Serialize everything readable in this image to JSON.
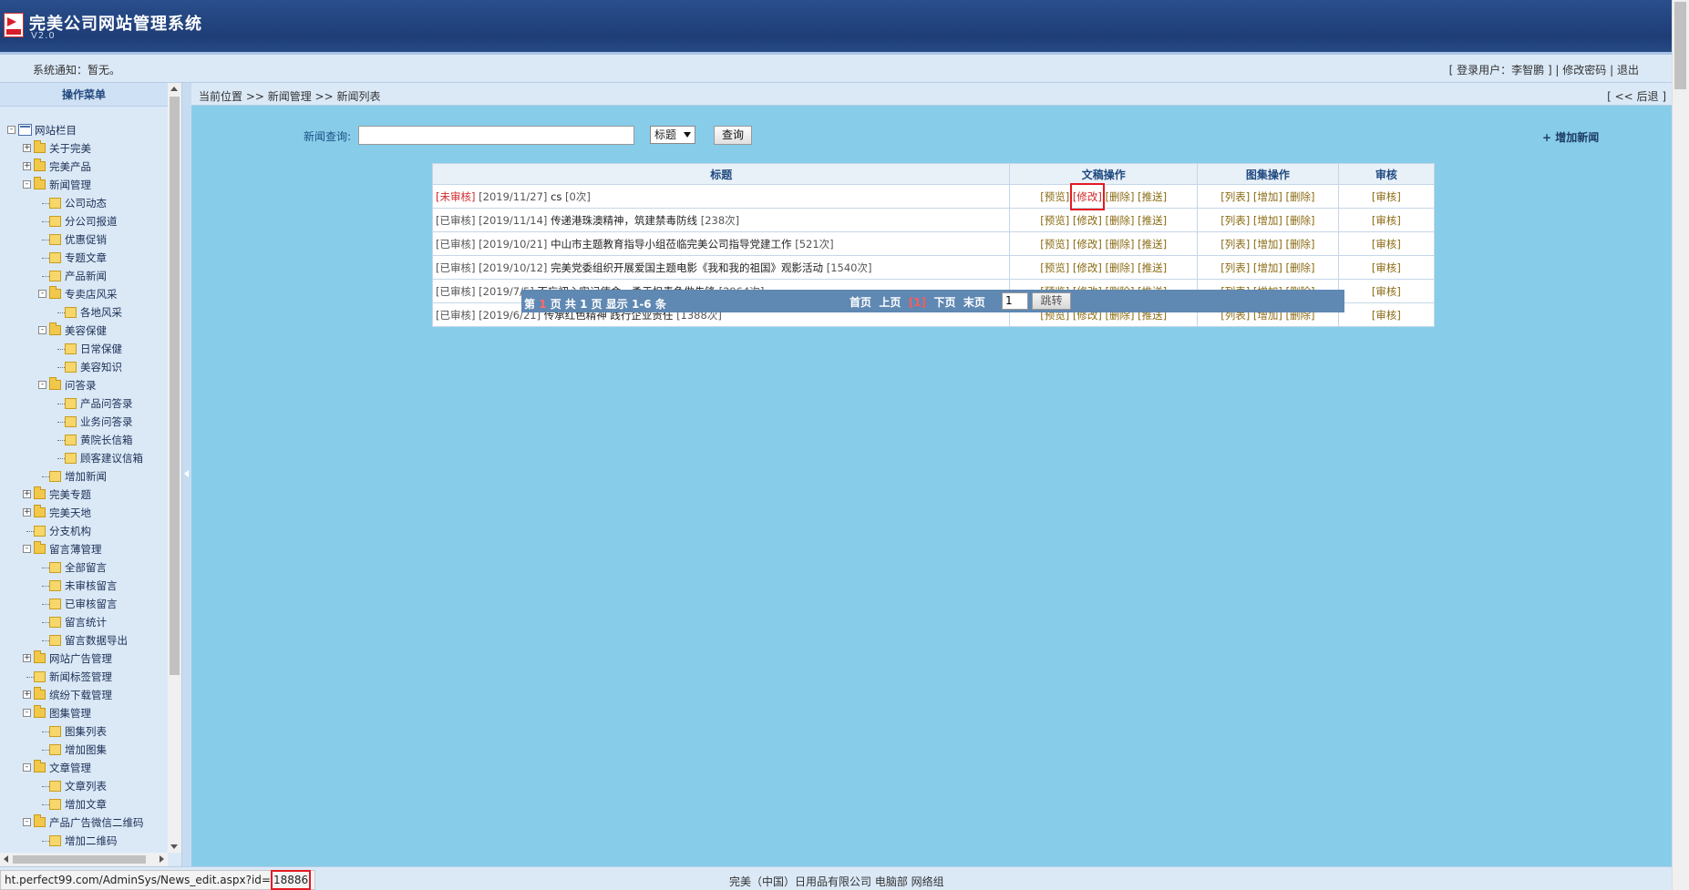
{
  "app": {
    "title": "完美公司网站管理系统",
    "version": "V2.0"
  },
  "notice": "系统通知：暂无。",
  "user_bar": {
    "login_prefix": "[ 登录用户：",
    "username": "李智鹏",
    "login_suffix": " ] | ",
    "change_password": "修改密码",
    "sep": " | ",
    "logout": "退出"
  },
  "sidebar": {
    "title": "操作菜单",
    "items": [
      {
        "label": "网站栏目",
        "level": 0,
        "type": "root",
        "toggle": "-"
      },
      {
        "label": "关于完美",
        "level": 1,
        "type": "folder",
        "toggle": "+"
      },
      {
        "label": "完美产品",
        "level": 1,
        "type": "folder",
        "toggle": "+"
      },
      {
        "label": "新闻管理",
        "level": 1,
        "type": "folder",
        "toggle": "-"
      },
      {
        "label": "公司动态",
        "level": 2,
        "type": "doc"
      },
      {
        "label": "分公司报道",
        "level": 2,
        "type": "doc"
      },
      {
        "label": "优惠促销",
        "level": 2,
        "type": "doc"
      },
      {
        "label": "专题文章",
        "level": 2,
        "type": "doc"
      },
      {
        "label": "产品新闻",
        "level": 2,
        "type": "doc"
      },
      {
        "label": "专卖店风采",
        "level": 2,
        "type": "folder",
        "toggle": "-"
      },
      {
        "label": "各地风采",
        "level": 3,
        "type": "doc"
      },
      {
        "label": "美容保健",
        "level": 2,
        "type": "folder",
        "toggle": "-"
      },
      {
        "label": "日常保健",
        "level": 3,
        "type": "doc"
      },
      {
        "label": "美容知识",
        "level": 3,
        "type": "doc"
      },
      {
        "label": "问答录",
        "level": 2,
        "type": "folder",
        "toggle": "-"
      },
      {
        "label": "产品问答录",
        "level": 3,
        "type": "doc"
      },
      {
        "label": "业务问答录",
        "level": 3,
        "type": "doc"
      },
      {
        "label": "黄院长信箱",
        "level": 3,
        "type": "doc"
      },
      {
        "label": "顾客建议信箱",
        "level": 3,
        "type": "doc"
      },
      {
        "label": "增加新闻",
        "level": 2,
        "type": "doc"
      },
      {
        "label": "完美专题",
        "level": 1,
        "type": "folder",
        "toggle": "+"
      },
      {
        "label": "完美天地",
        "level": 1,
        "type": "folder",
        "toggle": "+"
      },
      {
        "label": "分支机构",
        "level": 1,
        "type": "doc"
      },
      {
        "label": "留言薄管理",
        "level": 1,
        "type": "folder",
        "toggle": "-"
      },
      {
        "label": "全部留言",
        "level": 2,
        "type": "doc"
      },
      {
        "label": "未审核留言",
        "level": 2,
        "type": "doc"
      },
      {
        "label": "已审核留言",
        "level": 2,
        "type": "doc"
      },
      {
        "label": "留言统计",
        "level": 2,
        "type": "doc"
      },
      {
        "label": "留言数据导出",
        "level": 2,
        "type": "doc"
      },
      {
        "label": "网站广告管理",
        "level": 1,
        "type": "folder",
        "toggle": "+"
      },
      {
        "label": "新闻标签管理",
        "level": 1,
        "type": "doc"
      },
      {
        "label": "缤纷下载管理",
        "level": 1,
        "type": "folder",
        "toggle": "+"
      },
      {
        "label": "图集管理",
        "level": 1,
        "type": "folder",
        "toggle": "-"
      },
      {
        "label": "图集列表",
        "level": 2,
        "type": "doc"
      },
      {
        "label": "增加图集",
        "level": 2,
        "type": "doc"
      },
      {
        "label": "文章管理",
        "level": 1,
        "type": "folder",
        "toggle": "-"
      },
      {
        "label": "文章列表",
        "level": 2,
        "type": "doc"
      },
      {
        "label": "增加文章",
        "level": 2,
        "type": "doc"
      },
      {
        "label": "产品广告微信二维码",
        "level": 1,
        "type": "folder",
        "toggle": "-"
      },
      {
        "label": "增加二维码",
        "level": 2,
        "type": "doc"
      }
    ]
  },
  "breadcrumb": "当前位置 >> 新闻管理 >> 新闻列表",
  "back_link": "[ << 后退 ]",
  "search": {
    "label": "新闻查询:",
    "value": "",
    "select_value": "标题",
    "button": "查询"
  },
  "add_news": "+ 增加新闻",
  "table": {
    "headers": [
      "标题",
      "文稿操作",
      "图集操作",
      "审核"
    ],
    "rows": [
      {
        "status": "[未审核]",
        "date": "[2019/11/27]",
        "title": "cs",
        "views": "[0次]",
        "pending": true
      },
      {
        "status": "[已审核]",
        "date": "[2019/11/14]",
        "title": "传递港珠澳精神，筑建禁毒防线",
        "views": "[238次]",
        "pending": false
      },
      {
        "status": "[已审核]",
        "date": "[2019/10/21]",
        "title": "中山市主题教育指导小组莅临完美公司指导党建工作",
        "views": "[521次]",
        "pending": false
      },
      {
        "status": "[已审核]",
        "date": "[2019/10/12]",
        "title": "完美党委组织开展爱国主题电影《我和我的祖国》观影活动",
        "views": "[1540次]",
        "pending": false
      },
      {
        "status": "[已审核]",
        "date": "[2019/7/5]",
        "title": "不忘初心牢记使命，勇于担责争做先锋",
        "views": "[2964次]",
        "pending": false
      },
      {
        "status": "[已审核]",
        "date": "[2019/6/21]",
        "title": "传承红色精神 践行企业责任",
        "views": "[1388次]",
        "pending": false
      }
    ],
    "doc_ops": [
      "[预览]",
      "[修改]",
      "[删除]",
      "[推送]"
    ],
    "album_ops": [
      "[列表]",
      "[增加]",
      "[删除]"
    ],
    "audit_op": "[审核]"
  },
  "pager": {
    "prefix": "第 ",
    "current": "1",
    "suffix": " 页 共 1 页 显示 1-6 条",
    "first": "首页",
    "prev": "上页",
    "page_link": "[1]",
    "next": "下页",
    "last": "末页",
    "goto_value": "1",
    "goto_button": "跳转"
  },
  "footer": "完美（中国）日用品有限公司 电脑部 网络组",
  "status_url": {
    "base": "ht.perfect99.com/AdminSys/News_edit.aspx?id=",
    "id": "18886"
  },
  "colors": {
    "header": "#1e3d77",
    "content_bg": "#87cde9",
    "pending": "#d12a2a",
    "highlight": "#e31b23"
  }
}
